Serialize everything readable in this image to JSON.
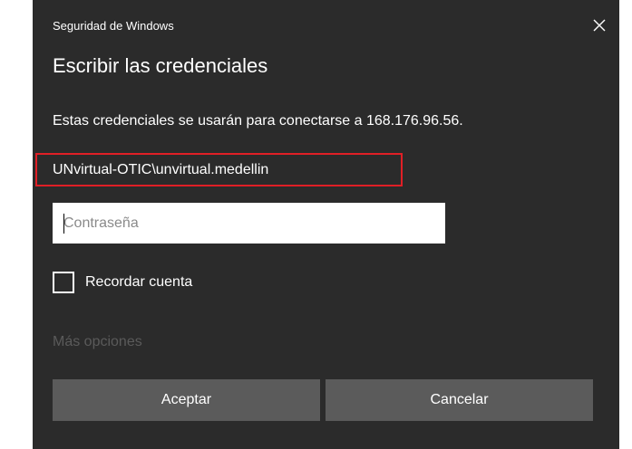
{
  "dialog": {
    "app_title": "Seguridad de Windows",
    "heading": "Escribir las credenciales",
    "message": "Estas credenciales se usarán para conectarse a 168.176.96.56.",
    "username": "UNvirtual-OTIC\\unvirtual.medellin",
    "password": {
      "value": "",
      "placeholder": "Contraseña"
    },
    "remember_label": "Recordar cuenta",
    "remember_checked": false,
    "more_options_label": "Más opciones",
    "ok_label": "Aceptar",
    "cancel_label": "Cancelar"
  },
  "icons": {
    "close": "close-icon"
  },
  "colors": {
    "background": "#2b2b2b",
    "button": "#5b5b5b",
    "highlight": "#e01f26",
    "disabled_text": "#5a5a5a"
  }
}
